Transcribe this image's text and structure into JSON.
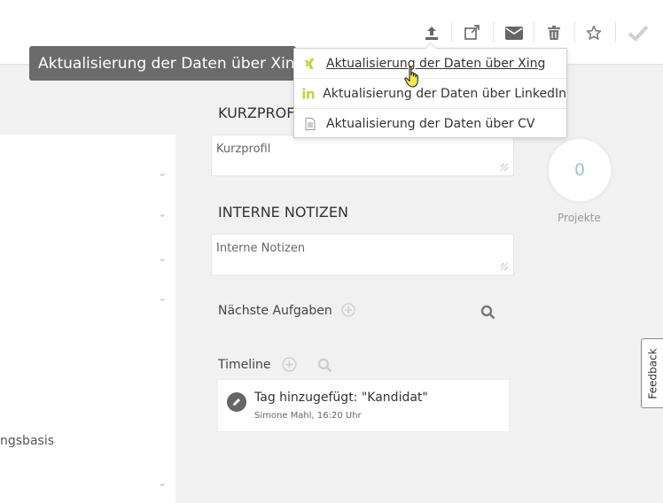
{
  "toolbar": {
    "icons": [
      "upload-icon",
      "external-link-icon",
      "envelope-icon",
      "trash-icon",
      "star-icon",
      "check-icon"
    ]
  },
  "tooltip": {
    "text": "Aktualisierung der Daten über Xing"
  },
  "dropdown": {
    "items": [
      {
        "label": "Aktualisierung der Daten über Xing",
        "icon": "xing-icon",
        "color": "#c9d23b"
      },
      {
        "label": "Aktualisierung der Daten über LinkedIn",
        "icon": "linkedin-icon",
        "color": "#c9d23b"
      },
      {
        "label": "Aktualisierung der Daten über CV",
        "icon": "document-icon",
        "color": "#999999"
      }
    ]
  },
  "left": {
    "partial_label": "ngsbasis"
  },
  "kurzprofil": {
    "title": "KURZPROFIL",
    "placeholder": "Kurzprofil"
  },
  "notizen": {
    "title": "INTERNE NOTIZEN",
    "placeholder": "Interne Notizen"
  },
  "aufgaben": {
    "label": "Nächste Aufgaben"
  },
  "timeline": {
    "label": "Timeline",
    "entries": [
      {
        "title": "Tag hinzugefügt: \"Kandidat\"",
        "meta": "Simone Mahl, 16:20 Uhr"
      }
    ]
  },
  "projects": {
    "count": "0",
    "label": "Projekte"
  },
  "feedback": {
    "label": "Feedback"
  },
  "colors": {
    "accent": "#c9d23b",
    "tooltip_bg": "#6b6b6b",
    "project_number": "#9cc4e0"
  }
}
